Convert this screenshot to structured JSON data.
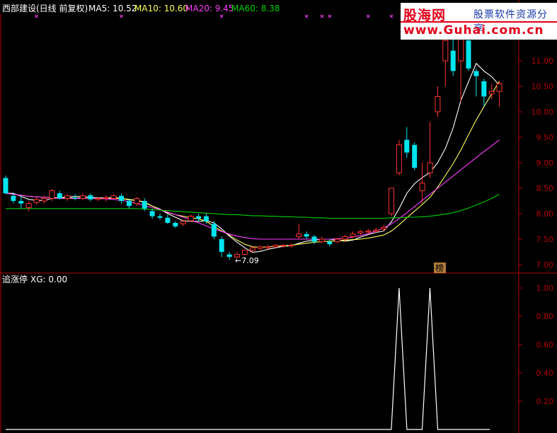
{
  "header": {
    "stock_title": "西部建设(日线 前复权)",
    "ma5_label": "MA5: 10.52",
    "ma10_label": "MA10: 10.60",
    "ma20_label": "MA20: 9.45",
    "ma60_label": "MA60: 8.38"
  },
  "indicator_header": {
    "name": "追涨停",
    "xg_label": "XG: 0.00"
  },
  "annotations": {
    "low_marker": "←7.09",
    "list_marker": "榜"
  },
  "watermark": {
    "brand": "股海网",
    "slogan": "股票软件资源分享",
    "url": "www.Guhai.com.cn"
  },
  "colors": {
    "up": "#ff3232",
    "down": "#00e5ee",
    "ma5": "#ffffff",
    "ma10": "#ffff5a",
    "ma20": "#ff3cff",
    "ma60": "#00d200",
    "axis": "#b40000",
    "xg_line": "#ffffff",
    "marker": "#ff3cff"
  },
  "chart_data": [
    {
      "type": "candlestick",
      "title": "",
      "ylim": [
        6.95,
        11.55
      ],
      "yticks": [
        7.0,
        7.5,
        8.0,
        8.5,
        9.0,
        9.5,
        10.0,
        10.5,
        11.0
      ],
      "candles": [
        [
          8.7,
          8.4,
          8.75,
          8.38
        ],
        [
          8.35,
          8.25,
          8.4,
          8.2
        ],
        [
          8.25,
          8.2,
          8.35,
          8.1
        ],
        [
          8.12,
          8.2,
          8.25,
          8.05
        ],
        [
          8.22,
          8.28,
          8.32,
          8.18
        ],
        [
          8.25,
          8.3,
          8.35,
          8.2
        ],
        [
          8.3,
          8.45,
          8.48,
          8.25
        ],
        [
          8.4,
          8.3,
          8.45,
          8.28
        ],
        [
          8.3,
          8.35,
          8.38,
          8.25
        ],
        [
          8.32,
          8.3,
          8.38,
          8.26
        ],
        [
          8.3,
          8.35,
          8.4,
          8.26
        ],
        [
          8.36,
          8.28,
          8.4,
          8.24
        ],
        [
          8.28,
          8.3,
          8.33,
          8.25
        ],
        [
          8.3,
          8.32,
          8.36,
          8.24
        ],
        [
          8.3,
          8.35,
          8.38,
          8.28
        ],
        [
          8.35,
          8.25,
          8.4,
          8.2
        ],
        [
          8.25,
          8.15,
          8.28,
          8.1
        ],
        [
          8.2,
          8.3,
          8.33,
          8.15
        ],
        [
          8.25,
          8.1,
          8.3,
          8.05
        ],
        [
          8.05,
          7.95,
          8.1,
          7.9
        ],
        [
          7.95,
          7.92,
          8.0,
          7.88
        ],
        [
          7.92,
          7.82,
          7.98,
          7.8
        ],
        [
          7.82,
          7.75,
          7.85,
          7.72
        ],
        [
          7.8,
          7.85,
          7.88,
          7.76
        ],
        [
          7.86,
          7.95,
          7.98,
          7.84
        ],
        [
          7.95,
          7.9,
          8.0,
          7.85
        ],
        [
          7.95,
          7.85,
          8.0,
          7.8
        ],
        [
          7.8,
          7.55,
          7.85,
          7.5
        ],
        [
          7.5,
          7.25,
          7.55,
          7.15
        ],
        [
          7.2,
          7.15,
          7.25,
          7.09
        ],
        [
          7.15,
          7.2,
          7.25,
          7.12
        ],
        [
          7.2,
          7.28,
          7.3,
          7.18
        ],
        [
          7.28,
          7.33,
          7.35,
          7.25
        ],
        [
          7.32,
          7.35,
          7.38,
          7.28
        ],
        [
          7.33,
          7.35,
          7.38,
          7.3
        ],
        [
          7.35,
          7.38,
          7.4,
          7.32
        ],
        [
          7.37,
          7.38,
          7.4,
          7.33
        ],
        [
          7.37,
          7.38,
          7.42,
          7.33
        ],
        [
          7.55,
          7.6,
          7.8,
          7.5
        ],
        [
          7.6,
          7.55,
          7.65,
          7.5
        ],
        [
          7.55,
          7.45,
          7.58,
          7.4
        ],
        [
          7.45,
          7.5,
          7.55,
          7.42
        ],
        [
          7.45,
          7.4,
          7.5,
          7.36
        ],
        [
          7.45,
          7.5,
          7.52,
          7.42
        ],
        [
          7.5,
          7.55,
          7.58,
          7.45
        ],
        [
          7.55,
          7.6,
          7.65,
          7.52
        ],
        [
          7.62,
          7.65,
          7.68,
          7.58
        ],
        [
          7.64,
          7.66,
          7.7,
          7.6
        ],
        [
          7.66,
          7.68,
          7.72,
          7.62
        ],
        [
          7.7,
          7.73,
          7.78,
          7.65
        ],
        [
          8.0,
          8.5,
          8.5,
          7.95
        ],
        [
          8.8,
          9.35,
          9.45,
          8.75
        ],
        [
          9.45,
          9.2,
          9.7,
          9.1
        ],
        [
          9.35,
          8.9,
          9.4,
          8.85
        ],
        [
          8.45,
          8.6,
          9.0,
          8.2
        ],
        [
          8.8,
          9.0,
          9.8,
          8.7
        ],
        [
          10.0,
          10.3,
          10.5,
          9.9
        ],
        [
          11.0,
          11.4,
          11.45,
          10.5
        ],
        [
          11.2,
          10.8,
          11.5,
          10.7
        ],
        [
          11.0,
          11.6,
          11.7,
          10.2
        ],
        [
          11.4,
          10.85,
          11.6,
          10.8
        ],
        [
          10.8,
          10.7,
          10.85,
          10.3
        ],
        [
          10.6,
          10.3,
          10.65,
          10.1
        ],
        [
          10.35,
          10.4,
          10.55,
          10.25
        ],
        [
          10.4,
          10.55,
          10.6,
          10.1
        ]
      ],
      "series": [
        {
          "name": "MA5",
          "values": [
            8.4,
            8.4,
            8.34,
            8.28,
            8.26,
            8.26,
            8.3,
            8.31,
            8.33,
            8.34,
            8.34,
            8.32,
            8.31,
            8.31,
            8.32,
            8.3,
            8.27,
            8.26,
            8.23,
            8.15,
            8.09,
            8.0,
            7.93,
            7.86,
            7.85,
            7.85,
            7.86,
            7.82,
            7.7,
            7.56,
            7.44,
            7.33,
            7.24,
            7.26,
            7.3,
            7.33,
            7.36,
            7.37,
            7.42,
            7.46,
            7.48,
            7.5,
            7.5,
            7.48,
            7.46,
            7.48,
            7.54,
            7.59,
            7.63,
            7.66,
            7.84,
            8.1,
            8.4,
            8.59,
            8.71,
            8.81,
            9.0,
            9.28,
            9.68,
            10.22,
            10.59,
            10.95,
            10.8,
            10.69,
            10.52
          ]
        },
        {
          "name": "MA10",
          "values": [
            8.4,
            8.38,
            8.36,
            8.34,
            8.33,
            8.32,
            8.32,
            8.31,
            8.31,
            8.31,
            8.31,
            8.3,
            8.3,
            8.3,
            8.3,
            8.3,
            8.28,
            8.26,
            8.22,
            8.15,
            8.08,
            8.02,
            7.98,
            7.95,
            7.92,
            7.9,
            7.85,
            7.75,
            7.66,
            7.58,
            7.48,
            7.4,
            7.35,
            7.34,
            7.35,
            7.36,
            7.37,
            7.38,
            7.4,
            7.42,
            7.44,
            7.45,
            7.46,
            7.47,
            7.48,
            7.49,
            7.5,
            7.52,
            7.55,
            7.58,
            7.66,
            7.78,
            7.92,
            8.05,
            8.18,
            8.32,
            8.52,
            8.75,
            8.98,
            9.25,
            9.55,
            9.84,
            10.1,
            10.35,
            10.6
          ]
        },
        {
          "name": "MA20",
          "values": [
            8.4,
            8.38,
            8.36,
            8.34,
            8.33,
            8.32,
            8.31,
            8.3,
            8.3,
            8.3,
            8.3,
            8.3,
            8.3,
            8.29,
            8.28,
            8.26,
            8.24,
            8.2,
            8.16,
            8.12,
            8.08,
            8.03,
            7.98,
            7.93,
            7.88,
            7.82,
            7.76,
            7.7,
            7.65,
            7.6,
            7.56,
            7.53,
            7.51,
            7.5,
            7.5,
            7.5,
            7.5,
            7.5,
            7.5,
            7.5,
            7.5,
            7.5,
            7.5,
            7.51,
            7.52,
            7.54,
            7.57,
            7.61,
            7.66,
            7.72,
            7.8,
            7.9,
            8.02,
            8.14,
            8.26,
            8.38,
            8.5,
            8.62,
            8.74,
            8.86,
            8.98,
            9.1,
            9.22,
            9.33,
            9.45
          ]
        },
        {
          "name": "MA60",
          "values": [
            8.1,
            8.1,
            8.1,
            8.1,
            8.1,
            8.1,
            8.1,
            8.1,
            8.1,
            8.1,
            8.1,
            8.1,
            8.1,
            8.1,
            8.1,
            8.1,
            8.1,
            8.1,
            8.09,
            8.08,
            8.07,
            8.06,
            8.05,
            8.04,
            8.03,
            8.02,
            8.01,
            8.0,
            7.99,
            7.98,
            7.98,
            7.97,
            7.96,
            7.96,
            7.95,
            7.95,
            7.94,
            7.94,
            7.93,
            7.93,
            7.92,
            7.92,
            7.91,
            7.91,
            7.91,
            7.91,
            7.91,
            7.91,
            7.91,
            7.91,
            7.92,
            7.92,
            7.93,
            7.93,
            7.94,
            7.95,
            7.97,
            7.99,
            8.02,
            8.06,
            8.11,
            8.17,
            8.23,
            8.3,
            8.38
          ]
        }
      ]
    },
    {
      "type": "line",
      "title": "",
      "ylim": [
        0,
        1.08
      ],
      "yticks": [
        0.2,
        0.4,
        0.6,
        0.8,
        1.0
      ],
      "series": [
        {
          "name": "XG",
          "values": [
            0,
            0,
            0,
            0,
            0,
            0,
            0,
            0,
            0,
            0,
            0,
            0,
            0,
            0,
            0,
            0,
            0,
            0,
            0,
            0,
            0,
            0,
            0,
            0,
            0,
            0,
            0,
            0,
            0,
            0,
            0,
            0,
            0,
            0,
            0,
            0,
            0,
            0,
            0,
            0,
            0,
            0,
            0,
            0,
            0,
            0,
            0,
            0,
            0,
            0,
            0,
            1,
            0,
            0,
            0,
            1,
            0,
            0,
            0,
            0,
            0,
            0,
            0,
            0,
            0
          ]
        }
      ]
    }
  ]
}
